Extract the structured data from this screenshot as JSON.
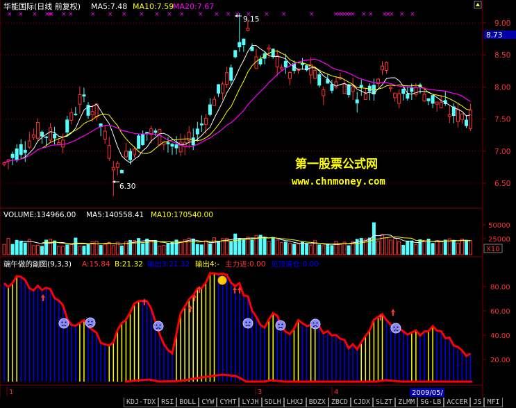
{
  "main_panel": {
    "stock_name": "华能国际(日线 前复权)",
    "ma5": "MA5:7.48",
    "ma10": "MA10:7.59",
    "ma20": "MA20:7.67",
    "price_axis": [
      "9.00",
      "8.50",
      "8.00",
      "7.50",
      "7.00",
      "6.50"
    ],
    "current_price_tag": "8.73",
    "high_label": "9.15",
    "low_label": "6.30",
    "watermark_line1": "第一股票公式网",
    "watermark_line2": "www.chnmoney.com"
  },
  "volume_panel": {
    "volume": "VOLUME:134966.00",
    "ma5": "MA5:140558.41",
    "ma10": "MA10:170540.00",
    "axis": [
      "50000",
      "25000"
    ],
    "unit": "X10"
  },
  "indicator_panel": {
    "title": "端午做的副图(9,3,3)",
    "a_value": "A:15.84",
    "b_value": "B:21.32",
    "out3": "输出3:21.32",
    "out4": "输出4:-",
    "main_in": "主力进:0.00",
    "retail_out": "见顶清仓:0.00",
    "axis": [
      "80.00",
      "60.00",
      "40.00",
      "20.00"
    ]
  },
  "time_axis": {
    "months": [
      "1",
      "3",
      "4"
    ],
    "date_box": "2009/05/"
  },
  "tabs": [
    "KDJ-TDX",
    "RSI",
    "BOLL",
    "CYW",
    "CYHT",
    "LYJH",
    "SDLH",
    "LHXJ",
    "BDZX",
    "ZBCD",
    "CJDX",
    "SLZT",
    "ZLMM",
    "SG-LB",
    "ACCER",
    "JS",
    "MFI"
  ],
  "colors": {
    "background": "#000000",
    "grid": "#800000",
    "up_candle": "#ff3232",
    "down_candle": "#54ffff",
    "ma5": "#ffffff",
    "ma10": "#ffff00",
    "ma20": "#ff00ff",
    "bar_blue": "#0000ff",
    "bar_yellow": "#ffff00",
    "curve_red": "#ff0000"
  }
}
